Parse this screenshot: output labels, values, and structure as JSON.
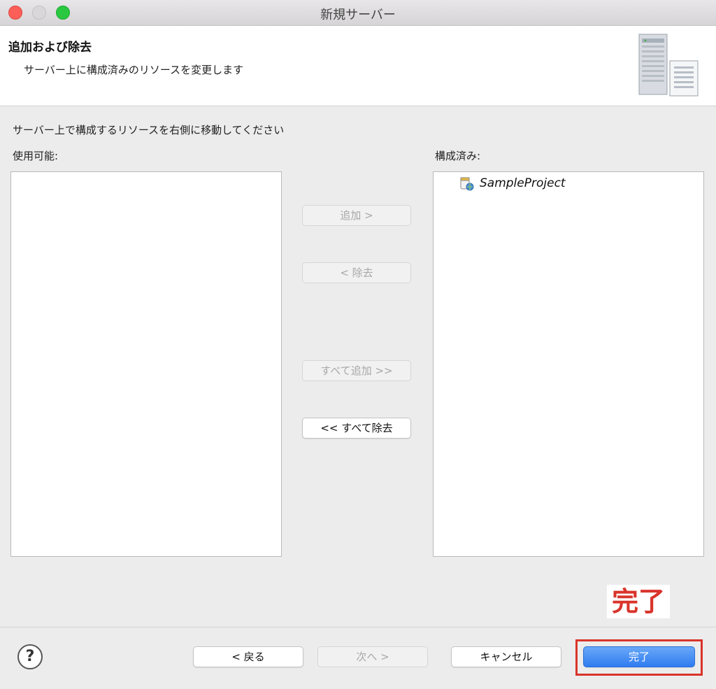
{
  "window": {
    "title": "新規サーバー"
  },
  "header": {
    "title": "追加および除去",
    "description": "サーバー上に構成済みのリソースを変更します"
  },
  "instruction": "サーバー上で構成するリソースを右側に移動してください",
  "available": {
    "label": "使用可能:",
    "items": []
  },
  "configured": {
    "label": "構成済み:",
    "items": [
      "SampleProject"
    ]
  },
  "buttons": {
    "add": "追加 >",
    "remove": "< 除去",
    "add_all": "すべて追加 >>",
    "remove_all": "<< すべて除去"
  },
  "footer": {
    "help": "?",
    "back": "< 戻る",
    "next": "次へ >",
    "cancel": "キャンセル",
    "finish": "完了"
  },
  "annotation": {
    "callout": "完了",
    "color": "#d9342b"
  }
}
